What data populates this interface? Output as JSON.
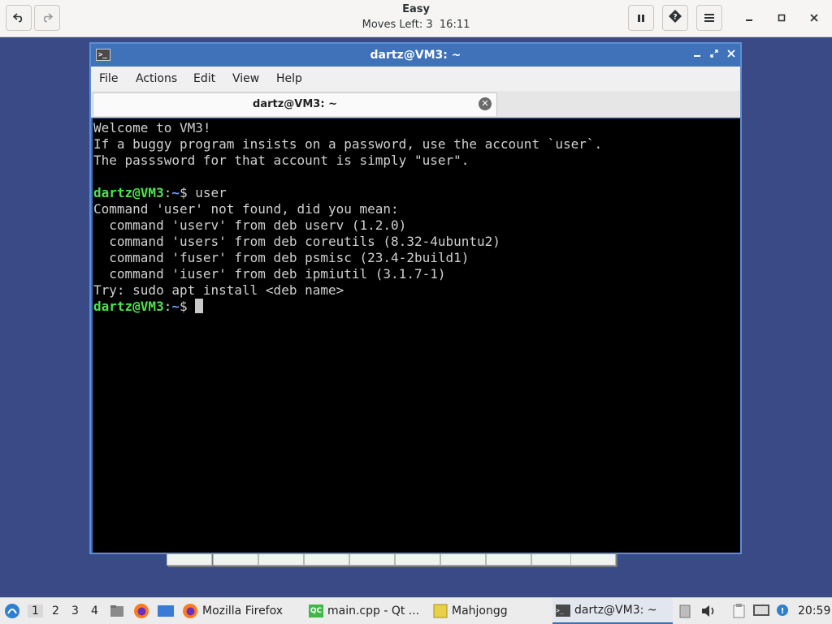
{
  "header_bar": {
    "title": "Easy",
    "moves_label": "Moves Left:",
    "moves_value": "3",
    "time": "16:11",
    "undo_icon": "undo-arrow",
    "redo_icon": "redo-arrow",
    "pause_icon": "pause",
    "hint_icon": "question-diamond",
    "menu_icon": "hamburger",
    "window_controls": [
      "minimize",
      "maximize",
      "close"
    ]
  },
  "terminal": {
    "window_title": "dartz@VM3: ~",
    "menu": [
      "File",
      "Actions",
      "Edit",
      "View",
      "Help"
    ],
    "tab_label": "dartz@VM3: ~",
    "prompt_user": "dartz@VM3",
    "prompt_dir": "~",
    "prompt_sym": "$",
    "lines": [
      "Welcome to VM3!",
      "If a buggy program insists on a password, use the account `user`.",
      "The passsword for that account is simply \"user\".",
      "",
      "Command 'user' not found, did you mean:",
      "  command 'userv' from deb userv (1.2.0)",
      "  command 'users' from deb coreutils (8.32-4ubuntu2)",
      "  command 'fuser' from deb psmisc (23.4-2build1)",
      "  command 'iuser' from deb ipmiutil (3.1.7-1)",
      "Try: sudo apt install <deb name>"
    ],
    "command_entered": " user",
    "accent_color": "#3f72b8",
    "prompt_color": "#4ee34e",
    "dir_color": "#6f9bff"
  },
  "taskbar": {
    "workspaces": [
      "1",
      "2",
      "3",
      "4"
    ],
    "tasks": [
      {
        "label": "Mozilla Firefox",
        "icon": "firefox-icon"
      },
      {
        "label": "main.cpp - Qt ...",
        "icon": "qt-creator-icon"
      },
      {
        "label": "Mahjongg",
        "icon": "mahjongg-icon"
      },
      {
        "label": "dartz@VM3: ~",
        "icon": "terminal-icon"
      }
    ],
    "clock": "20:59"
  }
}
